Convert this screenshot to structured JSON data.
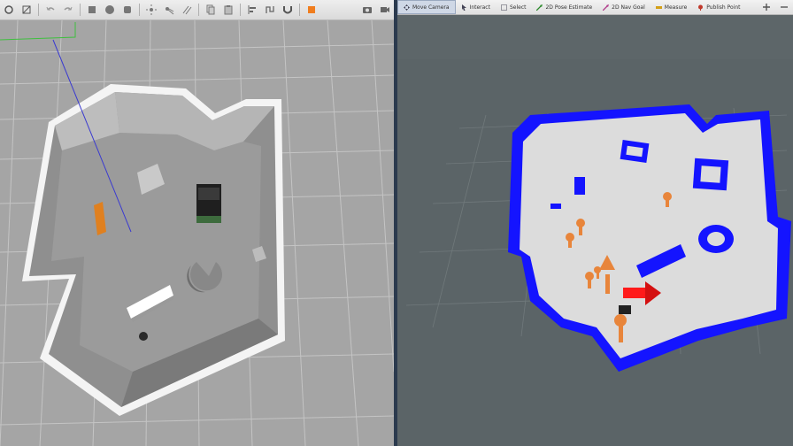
{
  "rviz": {
    "tools": [
      {
        "label": "Move Camera",
        "icon": "move-camera-icon",
        "active": true
      },
      {
        "label": "Interact",
        "icon": "interact-icon"
      },
      {
        "label": "Select",
        "icon": "select-icon"
      },
      {
        "label": "2D Pose Estimate",
        "icon": "pose-estimate-icon"
      },
      {
        "label": "2D Nav Goal",
        "icon": "nav-goal-icon"
      },
      {
        "label": "Measure",
        "icon": "measure-icon"
      },
      {
        "label": "Publish Point",
        "icon": "publish-point-icon"
      }
    ]
  },
  "gazebo": {
    "toolbar_icons": [
      "select-mode-icon",
      "translate-mode-icon",
      "undo-icon",
      "redo-icon",
      "box-shape-icon",
      "sphere-shape-icon",
      "cylinder-shape-icon",
      "point-light-icon",
      "spot-light-icon",
      "directional-light-icon",
      "copy-icon",
      "paste-icon",
      "align-icon",
      "snap-icon",
      "magnet-icon",
      "orange-color-icon",
      "screenshot-icon",
      "record-icon"
    ]
  },
  "colors": {
    "map_free": "#d9d9d9",
    "map_wall": "#1a1aff",
    "marker_arrow": "#e8853b",
    "goal_arrow": "#ff1a1a"
  }
}
